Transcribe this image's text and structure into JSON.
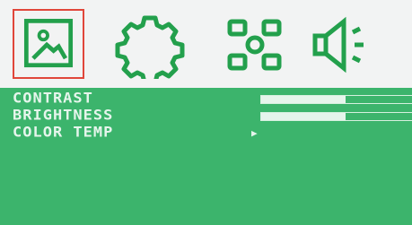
{
  "menu": {
    "items": [
      {
        "label": "CONTRAST",
        "type": "slider",
        "level": 0.55
      },
      {
        "label": "BRIGHTNESS",
        "type": "slider",
        "level": 0.55
      },
      {
        "label": "COLOR TEMP",
        "type": "submenu",
        "arrow": "▶"
      }
    ]
  },
  "icons": [
    "picture-icon",
    "gear-icon",
    "layout-icon",
    "speaker-icon"
  ],
  "colors": {
    "panel": "#3cb46c",
    "icon_green": "#23a04c",
    "selection": "#e0463a",
    "text": "#e6f5ec"
  }
}
